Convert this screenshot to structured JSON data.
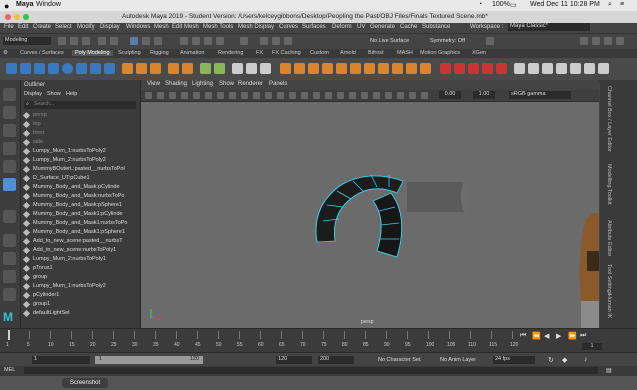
{
  "mac_menubar": {
    "app": "Maya",
    "window": "Window",
    "status": "100%",
    "datetime": "Wed Dec 11  10:28 PM"
  },
  "window_title": "Autodesk Maya 2019 - Student Version: /Users/kelceygibbons/Desktop/Peopling the Past/OBJ Files/Finals Textured Scene.mb*",
  "maya_menu": [
    "File",
    "Edit",
    "Create",
    "Select",
    "Modify",
    "Display",
    "Windows",
    "Mesh",
    "Edit Mesh",
    "Mesh Tools",
    "Mesh Display",
    "Curves",
    "Surfaces",
    "Deform",
    "UV",
    "Generate",
    "Cache",
    "Substance"
  ],
  "workspace": {
    "label": "Workspace :",
    "value": "Maya Classic*"
  },
  "status_line": {
    "mode": "Modeling",
    "live_surface": "No Live Surface",
    "symmetry": "Symmetry: Off"
  },
  "shelf_tabs": [
    "Curves / Surfaces",
    "Poly Modeling",
    "Sculpting",
    "Rigging",
    "Animation",
    "Rendering",
    "FX",
    "FX Caching",
    "Custom",
    "Arnold",
    "Bifrost",
    "MASH",
    "Motion Graphics",
    "XGen"
  ],
  "outliner": {
    "title": "Outliner",
    "menu": [
      "Display",
      "Show",
      "Help"
    ],
    "search_placeholder": "Search...",
    "items": [
      "persp",
      "top",
      "front",
      "side",
      "Lumpy_Mum_1:nurbsToPoly2",
      "Lumpy_Mum_2:nurbsToPoly2",
      "MummyBOuterL:pasted__nurbsToPol",
      "D_Surface_UT:pCube1",
      "Mummy_Body_and_Mask:pCylinde",
      "Mummy_Body_and_Mask:nurbsToPo",
      "Mummy_Body_and_Mask:pSphere1",
      "Mummy_Body_and_Mask1:pCylinde",
      "Mummy_Body_and_Mask1:nurbsToPo",
      "Mummy_Body_and_Mask1:pSphere1",
      "Add_to_new_scene:pasted__nurbsT",
      "Add_to_new_scene:nurbsToPoly1",
      "Lumpy_Mum_2:nurbsToPoly1",
      "pTorus1",
      "group",
      "Lumpy_Mum_1:nurbsToPoly2",
      "pCylinder1",
      "group1",
      "defaultLightSet"
    ]
  },
  "viewport": {
    "menu": [
      "View",
      "Shading",
      "Lighting",
      "Show",
      "Renderer",
      "Panels"
    ],
    "field1": "0.00",
    "field2": "1.00",
    "color_space": "sRGB gamma",
    "camera": "persp"
  },
  "side_tabs": [
    "Channel Box / Layer Editor",
    "Modelling Toolkit",
    "Attribute Editor",
    "Tool Settings",
    "Human IK"
  ],
  "timeline": {
    "ticks": [
      "1",
      "5",
      "10",
      "15",
      "20",
      "25",
      "30",
      "35",
      "40",
      "45",
      "50",
      "55",
      "60",
      "65",
      "70",
      "75",
      "80",
      "85",
      "90",
      "95",
      "100",
      "105",
      "110",
      "115",
      "120"
    ],
    "current": "1"
  },
  "range": {
    "start": "1",
    "start_inner": "1",
    "end_inner": "120",
    "end": "120",
    "anim_end": "200",
    "character_set": "No Character Set",
    "anim_layer": "No Anim Layer",
    "fps": "24 fps"
  },
  "command": {
    "label": "MEL"
  },
  "dock": {
    "screenshot": "Screenshot"
  }
}
